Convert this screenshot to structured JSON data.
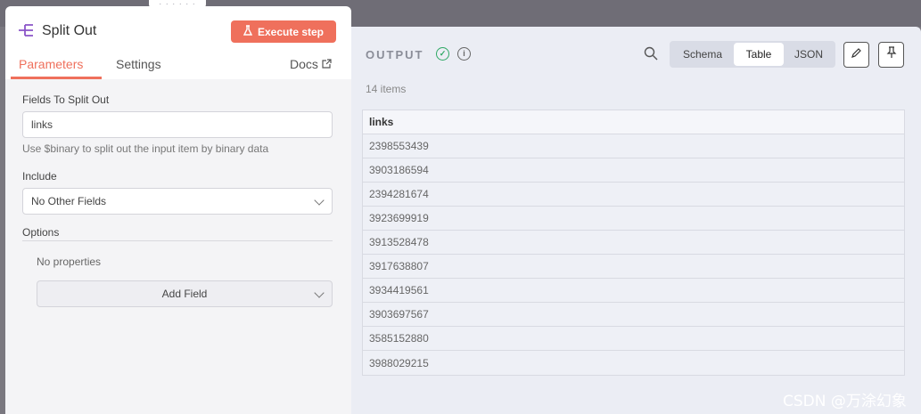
{
  "node": {
    "title": "Split Out",
    "execute_label": "Execute step",
    "tabs": [
      {
        "label": "Parameters",
        "active": true
      },
      {
        "label": "Settings",
        "active": false
      }
    ],
    "docs_label": "Docs"
  },
  "params": {
    "fields_label": "Fields To Split Out",
    "fields_value": "links",
    "hint": "Use $binary to split out the input item by binary data",
    "include_label": "Include",
    "include_value": "No Other Fields",
    "options_label": "Options",
    "no_properties": "No properties",
    "add_field_label": "Add Field"
  },
  "output": {
    "title": "OUTPUT",
    "status_icon": "check-circle-icon",
    "views": [
      "Schema",
      "Table",
      "JSON"
    ],
    "active_view": "Table",
    "count_text": "14 items",
    "column": "links",
    "rows": [
      "2398553439",
      "3903186594",
      "2394281674",
      "3923699919",
      "3913528478",
      "3917638807",
      "3934419561",
      "3903697567",
      "3585152880",
      "3988029215"
    ]
  },
  "colors": {
    "accent": "#ef705c",
    "success": "#2ea864",
    "node_icon": "#8a54c8"
  },
  "watermark": "CSDN @万涂幻象"
}
